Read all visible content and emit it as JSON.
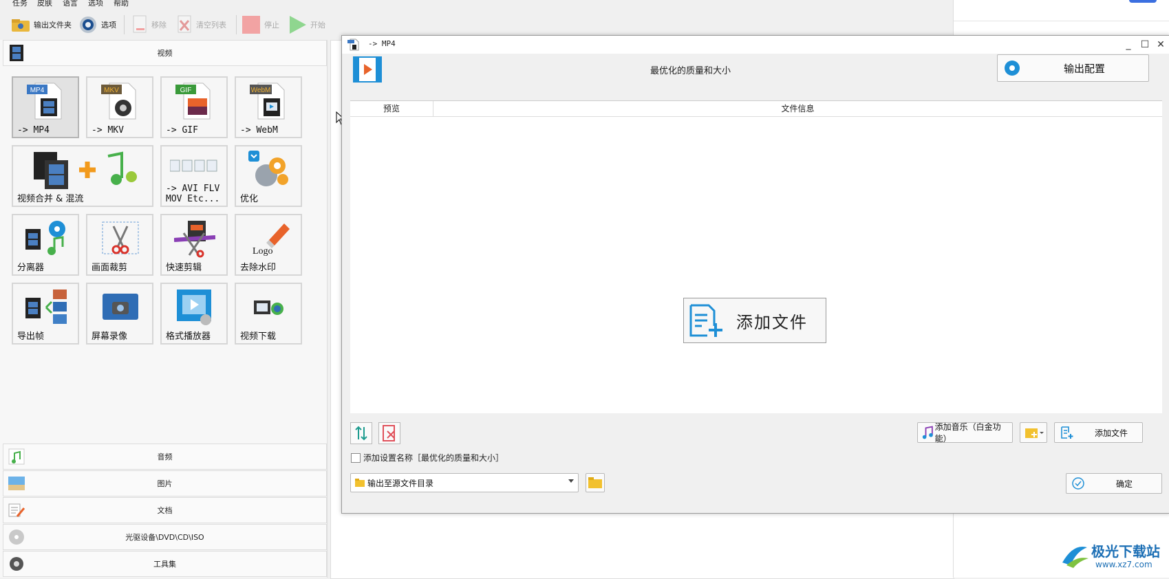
{
  "menu": [
    "任务",
    "皮肤",
    "语言",
    "选项",
    "帮助"
  ],
  "toolbar": {
    "output_folder": "输出文件夹",
    "options": "选项",
    "remove": "移除",
    "clear_list": "清空列表",
    "stop": "停止",
    "start": "开始"
  },
  "categories": {
    "video": "视频",
    "audio": "音频",
    "picture": "图片",
    "document": "文档",
    "rom": "光驱设备\\DVD\\CD\\ISO",
    "tools": "工具集"
  },
  "tiles": {
    "mp4": "-> MP4",
    "mkv": "-> MKV",
    "gif": "-> GIF",
    "webm": "-> WebM",
    "merge": "视频合并 & 混流",
    "avi": "-> AVI FLV\nMOV Etc...",
    "optimize": "优化",
    "splitter": "分离器",
    "crop": "画面裁剪",
    "quick_cut": "快速剪辑",
    "watermark": "去除水印",
    "export_frames": "导出帧",
    "screen_record": "屏幕录像",
    "player": "格式播放器",
    "download": "视频下载"
  },
  "badges": {
    "mp4": "MP4",
    "mkv": "MKV",
    "gif": "GIF",
    "webm": "WebM",
    "logo": "Logo"
  },
  "dialog": {
    "title": "-> MP4",
    "profile": "最优化的质量和大小",
    "output_config": "输出配置",
    "col_preview": "预览",
    "col_info": "文件信息",
    "add_file_big": "添加文件",
    "add_music": "添加音乐（白金功能）",
    "add_file": "添加文件",
    "add_setting_name": "添加设置名称［最优化的质量和大小］",
    "output_dir": "输出至源文件目录",
    "ok": "确定"
  },
  "watermark": {
    "name": "极光下载站",
    "url": "www.xz7.com"
  },
  "colors": {
    "accent": "#1e8fd6",
    "mp4_badge": "#3b78c4",
    "mkv_badge": "#6c5a3a",
    "gif_badge": "#3a9a3a",
    "webm_badge": "#555555"
  }
}
